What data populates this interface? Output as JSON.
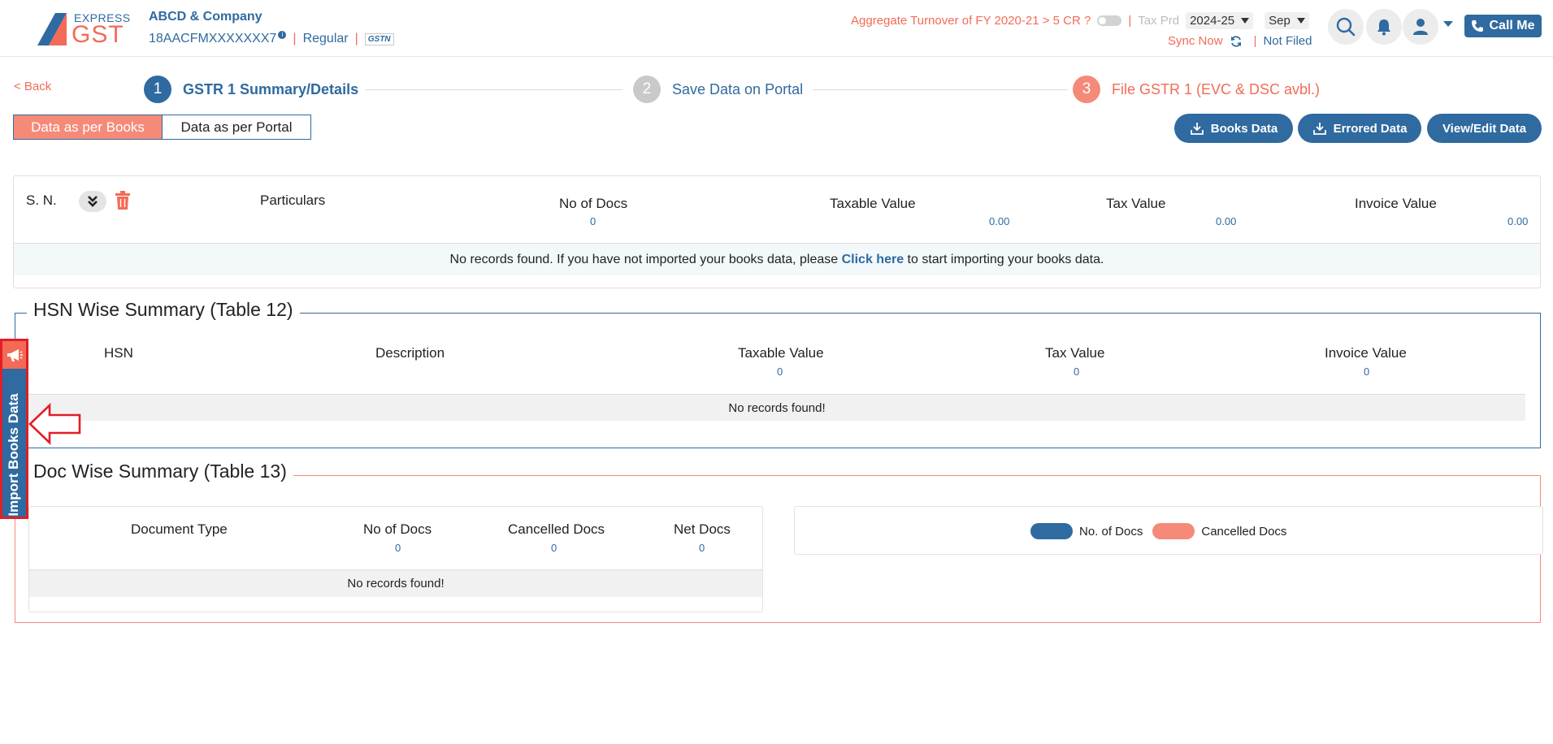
{
  "header": {
    "logo_top": "EXPRESS",
    "logo_bottom": "GST",
    "company_name": "ABCD & Company",
    "gstin": "18AACFMXXXXXXX7",
    "gstin_info": "i",
    "taxpayer_type": "Regular",
    "gstn_badge": "GSTN",
    "turnover_question": "Aggregate Turnover of FY 2020-21 > 5 CR ?",
    "tax_prd_label": "Tax Prd",
    "fy_value": "2024-25",
    "month_value": "Sep",
    "sync_now": "Sync Now",
    "status": "Not Filed",
    "call_me": "Call Me",
    "separator": "|",
    "colors": {
      "brand_blue": "#2f6aa0",
      "brand_orange": "#f36b57",
      "accent_red": "#e01f26"
    }
  },
  "steps": {
    "back": "< Back",
    "items": [
      {
        "num": "1",
        "label": "GSTR 1 Summary/Details"
      },
      {
        "num": "2",
        "label": "Save Data on Portal"
      },
      {
        "num": "3",
        "label": "File GSTR 1 (EVC & DSC avbl.)"
      }
    ]
  },
  "tabs": {
    "books": "Data as per Books",
    "portal": "Data as per Portal"
  },
  "actions": {
    "books_data": "Books Data",
    "errored_data": "Errored Data",
    "view_edit": "View/Edit Data"
  },
  "summary": {
    "headers": {
      "sn": "S. N.",
      "particulars": "Particulars",
      "no_of_docs": "No of Docs",
      "taxable_value": "Taxable Value",
      "tax_value": "Tax Value",
      "invoice_value": "Invoice Value"
    },
    "totals": {
      "no_of_docs": "0",
      "taxable_value": "0.00",
      "tax_value": "0.00",
      "invoice_value": "0.00"
    },
    "empty_pre": "No records found. If you have not imported your books data, please ",
    "empty_link": "Click here",
    "empty_post": " to start importing your books data."
  },
  "hsn": {
    "title": "HSN Wise Summary (Table 12)",
    "headers": {
      "hsn": "HSN",
      "description": "Description",
      "taxable_value": "Taxable Value",
      "tax_value": "Tax Value",
      "invoice_value": "Invoice Value"
    },
    "totals": {
      "taxable_value": "0",
      "tax_value": "0",
      "invoice_value": "0"
    },
    "empty": "No records found!"
  },
  "doc": {
    "title": "Doc Wise Summary (Table 13)",
    "headers": {
      "document_type": "Document Type",
      "no_of_docs": "No of Docs",
      "cancelled_docs": "Cancelled Docs",
      "net_docs": "Net Docs"
    },
    "totals": {
      "no_of_docs": "0",
      "cancelled_docs": "0",
      "net_docs": "0"
    },
    "empty": "No records found!",
    "legend": {
      "no_of_docs": "No. of Docs",
      "cancelled_docs": "Cancelled Docs"
    }
  },
  "side_tab": {
    "label": "Import Books Data"
  }
}
